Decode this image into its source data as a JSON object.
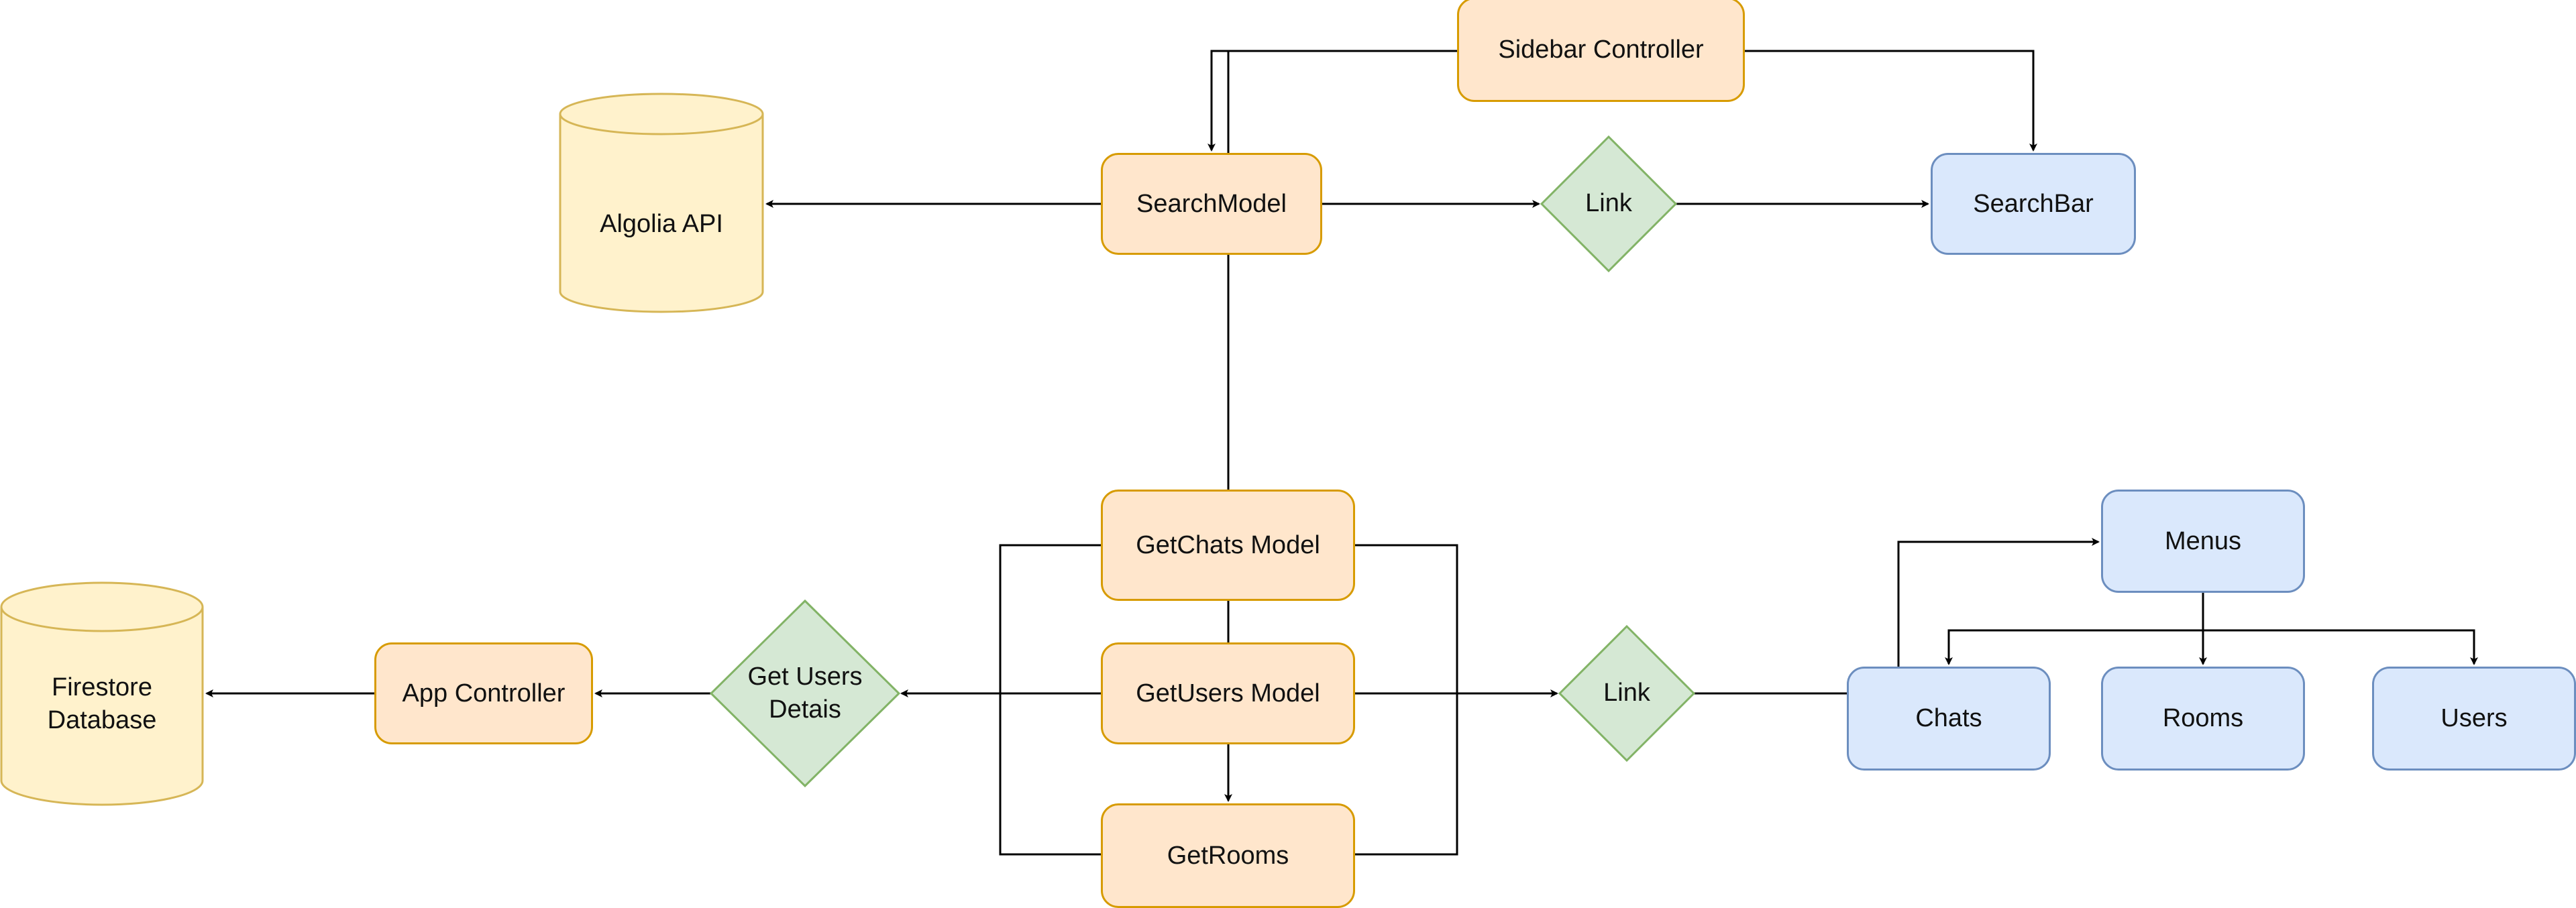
{
  "diagram": {
    "colors": {
      "controller_fill": "#ffe6cc",
      "controller_stroke": "#d79b00",
      "view_fill": "#dae8fc",
      "view_stroke": "#6c8ebf",
      "decision_fill": "#d5e8d4",
      "decision_stroke": "#82b366",
      "datastore_fill": "#fff2cc",
      "datastore_stroke": "#d6b656",
      "edge": "#000000"
    },
    "nodes": {
      "sidebar_controller": "Sidebar Controller",
      "search_model": "SearchModel",
      "link_top": "Link",
      "search_bar": "SearchBar",
      "algolia_api": "Algolia API",
      "getchats_model": "GetChats Model",
      "getusers_model": "GetUsers Model",
      "getrooms": "GetRooms",
      "link_bottom": "Link",
      "get_users_details": "Get Users Detais",
      "app_controller": "App Controller",
      "firestore_db": "Firestore Database",
      "menus": "Menus",
      "chats": "Chats",
      "rooms": "Rooms",
      "users": "Users"
    },
    "edges": [
      {
        "from": "Sidebar Controller",
        "to": "SearchModel",
        "arrow": true
      },
      {
        "from": "Sidebar Controller",
        "to": "SearchBar",
        "arrow": true
      },
      {
        "from": "SearchModel",
        "to": "Algolia API",
        "arrow": true
      },
      {
        "from": "SearchModel",
        "to": "Link",
        "arrow": true
      },
      {
        "from": "Link",
        "to": "SearchBar",
        "arrow": true
      },
      {
        "from": "SearchModel",
        "to": "GetChats Model",
        "arrow": false
      },
      {
        "from": "GetChats Model",
        "to": "GetUsers Model",
        "arrow": false
      },
      {
        "from": "GetUsers Model",
        "to": "GetRooms",
        "arrow": true
      },
      {
        "from": "GetUsers Model",
        "to": "Get Users Detais",
        "arrow": true
      },
      {
        "from": "Get Users Detais",
        "to": "App Controller",
        "arrow": true
      },
      {
        "from": "App Controller",
        "to": "Firestore Database",
        "arrow": true
      },
      {
        "from": "GetUsers Model",
        "to": "Link",
        "arrow": true
      },
      {
        "from": "Link",
        "to": "Menus",
        "arrow": true
      },
      {
        "from": "Menus",
        "to": "Chats",
        "arrow": true
      },
      {
        "from": "Menus",
        "to": "Rooms",
        "arrow": true
      },
      {
        "from": "Menus",
        "to": "Users",
        "arrow": true
      }
    ]
  }
}
